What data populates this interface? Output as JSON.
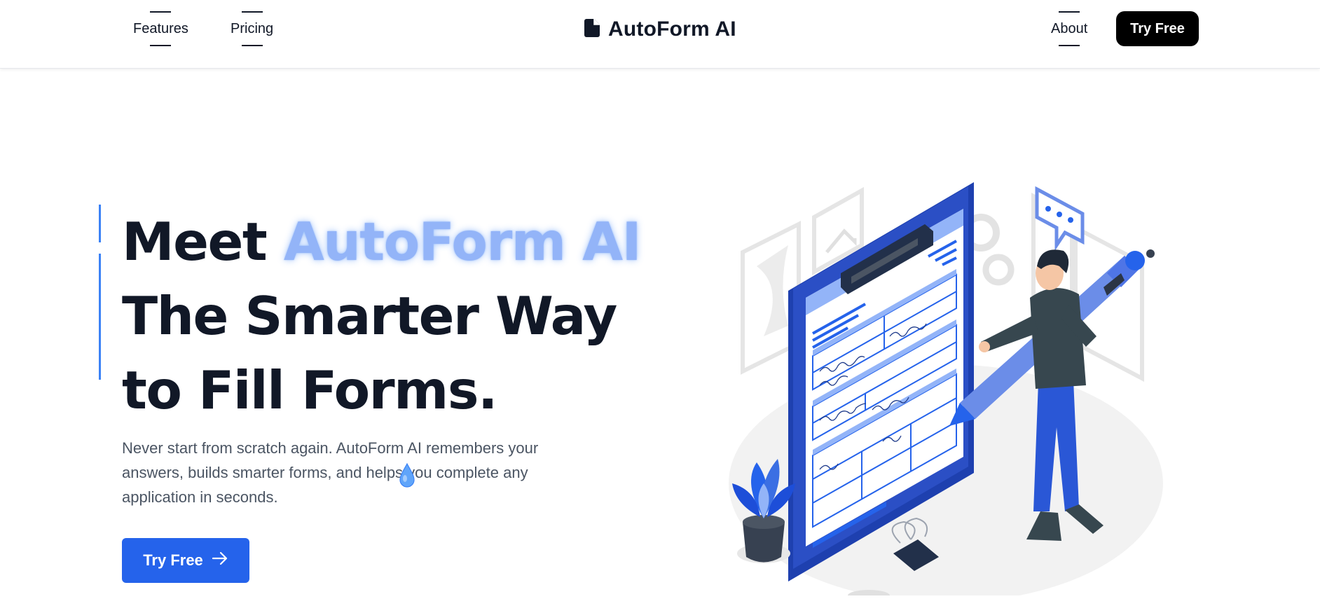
{
  "nav": {
    "features_label": "Features",
    "pricing_label": "Pricing",
    "about_label": "About",
    "cta_label": "Try Free",
    "brand_name": "AutoForm AI",
    "brand_icon": "document-icon"
  },
  "hero": {
    "title_prefix": "Meet ",
    "title_highlight": "AutoForm AI",
    "title_line2": "The Smarter Way",
    "title_line3": "to Fill Forms.",
    "description": "Never start from scratch again. AutoForm AI remembers your answers, builds smarter forms, and helps you complete any application in seconds.",
    "cta_label": "Try Free",
    "cta_icon": "arrow-right-icon"
  },
  "colors": {
    "accent": "#2563eb",
    "highlight": "#93b4f8",
    "heading": "#111827",
    "body_text": "#4b5563"
  }
}
